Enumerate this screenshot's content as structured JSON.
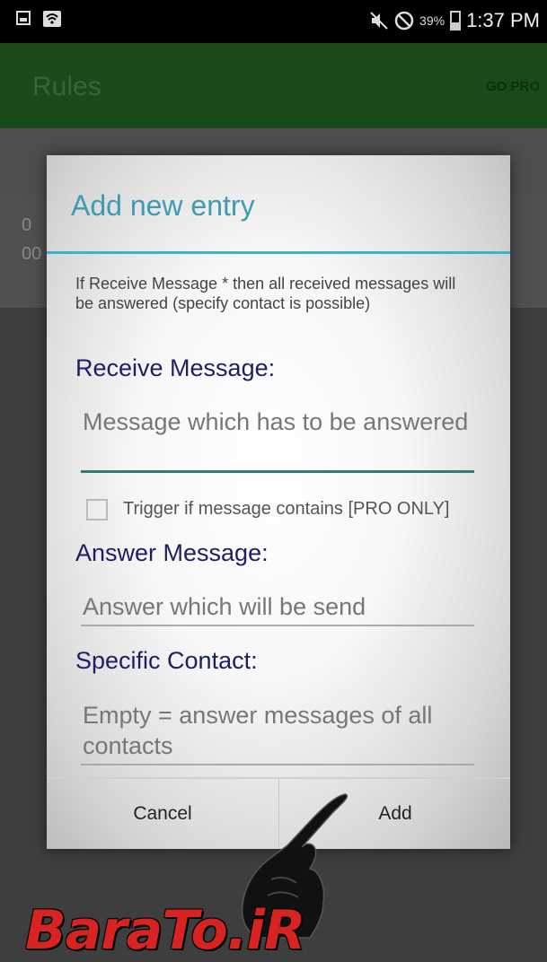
{
  "status_bar": {
    "battery_percent": "39%",
    "time": "1:37 PM",
    "battery_level": 0.39
  },
  "app_bar": {
    "title": "Rules",
    "go_pro": "GO PRO"
  },
  "background_list": {
    "line1": "0",
    "line2": "00"
  },
  "dialog": {
    "title": "Add new entry",
    "hint": "If Receive Message  *  then all received messages will be answered (specify contact is possible)",
    "receive_label": "Receive Message:",
    "receive_placeholder": "Message which has to be answered",
    "trigger_checkbox_label": "Trigger if message contains [PRO ONLY]",
    "answer_label": "Answer Message:",
    "answer_placeholder": "Answer which will be send",
    "contact_label": "Specific Contact:",
    "contact_placeholder": "Empty = answer messages of all contacts",
    "cancel_label": "Cancel",
    "add_label": "Add"
  },
  "watermark": "BaraTo.iR",
  "icons": [
    "gallery-icon",
    "wifi-icon",
    "mute-icon",
    "do-not-disturb-icon",
    "battery-icon",
    "pointing-hand-icon"
  ],
  "colors": {
    "accent": "#38b3d3",
    "label": "#1c1f66",
    "app_bar": "#1a4a1a",
    "watermark": "#d82323"
  }
}
